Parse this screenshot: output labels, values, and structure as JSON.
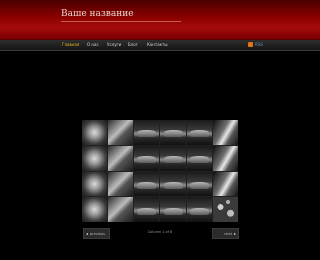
{
  "header": {
    "title": "Ваше название"
  },
  "nav": {
    "items": [
      {
        "label": "Главная",
        "active": true
      },
      {
        "label": "О нас",
        "active": false
      },
      {
        "label": "Услуги",
        "active": false
      },
      {
        "label": "Блог",
        "active": false
      },
      {
        "label": "Контакты",
        "active": false
      }
    ],
    "rss_label": "RSS"
  },
  "gallery": {
    "thumbnails": [
      {
        "subject": "flower"
      },
      {
        "subject": "leaf"
      },
      {
        "subject": "car"
      },
      {
        "subject": "car"
      },
      {
        "subject": "car"
      },
      {
        "subject": "silk"
      },
      {
        "subject": "flower"
      },
      {
        "subject": "leaf"
      },
      {
        "subject": "car"
      },
      {
        "subject": "car"
      },
      {
        "subject": "car"
      },
      {
        "subject": "silk"
      },
      {
        "subject": "flower"
      },
      {
        "subject": "leaf"
      },
      {
        "subject": "car"
      },
      {
        "subject": "car"
      },
      {
        "subject": "car"
      },
      {
        "subject": "silk"
      },
      {
        "subject": "flower"
      },
      {
        "subject": "leaf"
      },
      {
        "subject": "car"
      },
      {
        "subject": "car"
      },
      {
        "subject": "car"
      },
      {
        "subject": "drops"
      }
    ],
    "prev_label": "previous",
    "next_label": "next",
    "page_text": "Column 1 of 8"
  },
  "colors": {
    "header_red": "#8c0000",
    "nav_active": "#e6b820",
    "rss_orange": "#e27615"
  }
}
